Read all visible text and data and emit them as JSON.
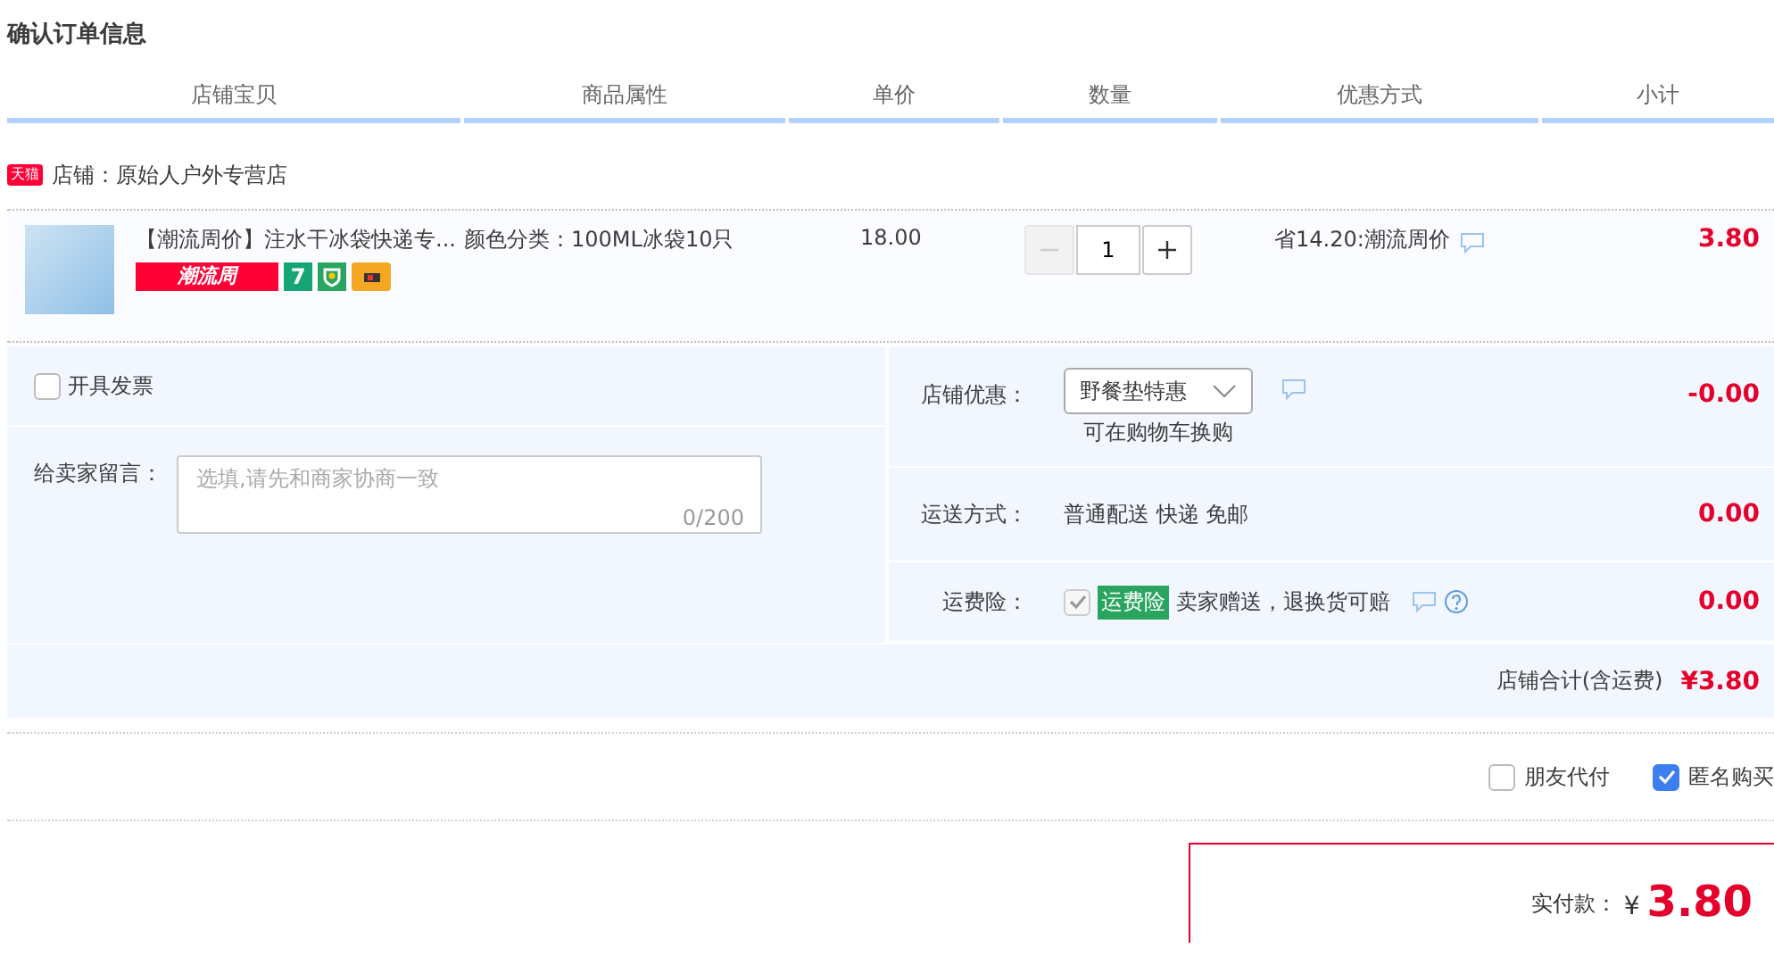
{
  "title": "确认订单信息",
  "columns": [
    "店铺宝贝",
    "商品属性",
    "单价",
    "数量",
    "优惠方式",
    "小计"
  ],
  "shop": {
    "badge": "天猫",
    "label": "店铺：原始人户外专营店"
  },
  "item": {
    "name": "【潮流周价】注水干冰袋快递专...",
    "promo_tag": "潮流周",
    "number_tag": "7",
    "attribute": "颜色分类：100ML冰袋10只",
    "price": "18.00",
    "quantity": {
      "value": "1",
      "minus_disabled": true
    },
    "discount": "省14.20:潮流周价",
    "subtotal": "3.80"
  },
  "invoice": {
    "label": "开具发票",
    "checked": false
  },
  "message": {
    "label": "给卖家留言：",
    "placeholder": "选填,请先和商家协商一致",
    "counter": "0/200"
  },
  "fees": [
    {
      "kind": "select",
      "label": "店铺优惠：",
      "value": "野餐垫特惠",
      "note": "可在购物车换购",
      "amount": "-0.00"
    },
    {
      "kind": "text",
      "label": "运送方式：",
      "value": "普通配送 快递 免邮",
      "amount": "0.00"
    },
    {
      "kind": "insurance",
      "label": "运费险：",
      "tag": "运费险",
      "value": "卖家赠送，退换货可赔",
      "checked": true,
      "disabled": true,
      "amount": "0.00"
    }
  ],
  "total": {
    "label": "店铺合计(含运费)",
    "value": "¥3.80"
  },
  "options": [
    {
      "label": "朋友代付",
      "checked": false
    },
    {
      "label": "匿名购买",
      "checked": true
    }
  ],
  "payment": {
    "label": "实付款：",
    "currency": "¥",
    "amount": "3.80"
  }
}
